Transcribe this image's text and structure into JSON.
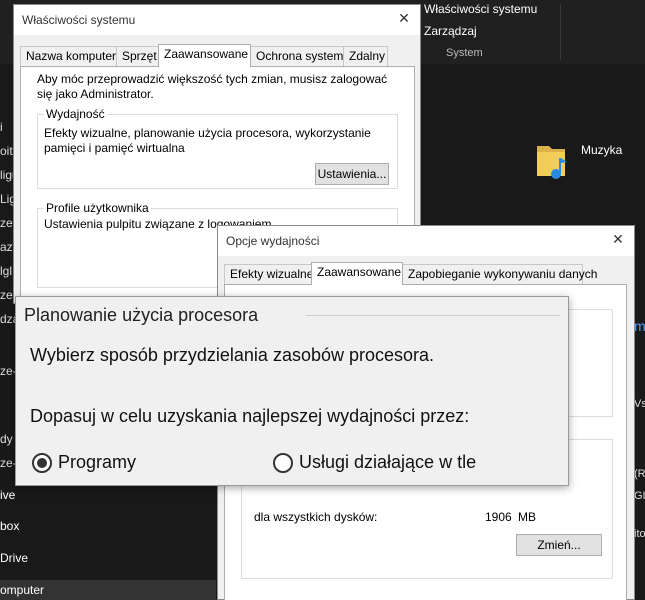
{
  "explorer": {
    "ribbon": {
      "item1": "Właściwości systemu",
      "item2": "Zarządzaj",
      "group_label": "System"
    },
    "folder_label": "Muzyka",
    "left_nav_fragments": [
      "i",
      "oit",
      "ligu",
      "Ligu",
      "ze-",
      "azy",
      "lgl",
      "ze-",
      "dzą",
      "ze-",
      "dy",
      "ze-"
    ],
    "left_nav_bottom": [
      "ive",
      "box",
      "Drive",
      "omputer"
    ],
    "right_fragments": [
      {
        "text": "m",
        "blue": true
      },
      {
        "text": "Vsz",
        "blue": false
      },
      {
        "text": "(R",
        "blue": false
      },
      {
        "text": "GI",
        "blue": false
      },
      {
        "text": "ito",
        "blue": false
      }
    ]
  },
  "system_props": {
    "title": "Właściwości systemu",
    "close": "✕",
    "tabs": [
      "Nazwa komputera",
      "Sprzęt",
      "Zaawansowane",
      "Ochrona systemu",
      "Zdalny"
    ],
    "admin_note": "Aby móc przeprowadzić większość tych zmian, musisz zalogować się jako Administrator.",
    "performance": {
      "title": "Wydajność",
      "text": "Efekty wizualne, planowanie użycia procesora, wykorzystanie pamięci i pamięć wirtualna",
      "button": "Ustawienia..."
    },
    "profiles": {
      "title": "Profile użytkownika",
      "text": "Ustawienia pulpitu związane z logowaniem"
    }
  },
  "perf_options": {
    "title": "Opcje wydajności",
    "close": "✕",
    "tabs": [
      "Efekty wizualne",
      "Zaawansowane",
      "Zapobieganie wykonywaniu danych"
    ],
    "vm_label": "dla wszystkich dysków:",
    "vm_value": "1906",
    "vm_unit": "MB",
    "change_button": "Zmień..."
  },
  "zoom": {
    "title": "Planowanie użycia procesora",
    "description": "Wybierz sposób przydzielania zasobów procesora.",
    "adjust": "Dopasuj w celu uzyskania najlepszej wydajności przez:",
    "option_programs": "Programy",
    "option_services": "Usługi działające w tle",
    "selected": "Programy"
  }
}
